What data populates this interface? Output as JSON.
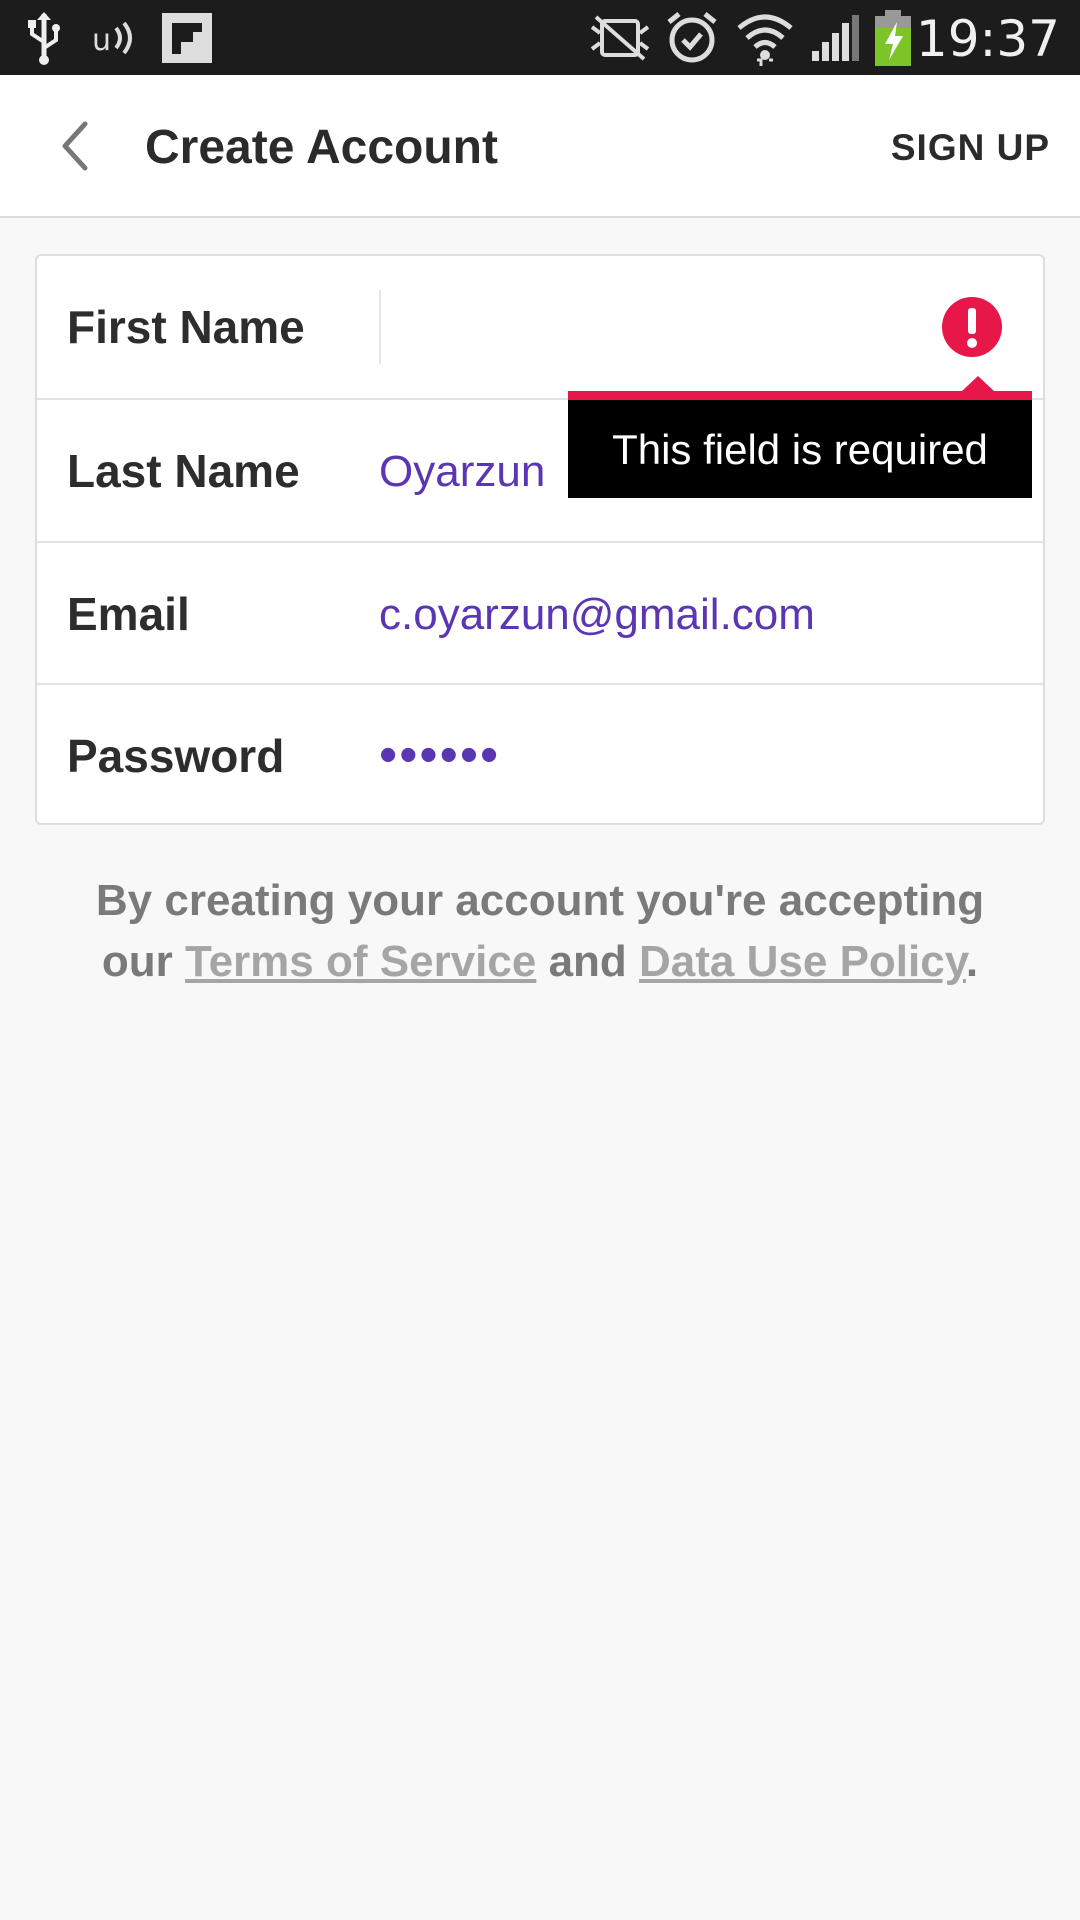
{
  "status_bar": {
    "time": "19:37",
    "icons": [
      "usb-icon",
      "nfc-icon",
      "flipboard-icon",
      "mute-icon",
      "alarm-icon",
      "wifi-icon",
      "signal-icon",
      "battery-charging-icon"
    ],
    "battery_color": "#7cc428"
  },
  "header": {
    "title": "Create Account",
    "signup_label": "SIGN UP"
  },
  "form": {
    "fields": [
      {
        "label": "First Name",
        "value": "",
        "error": true
      },
      {
        "label": "Last Name",
        "value": "Oyarzun"
      },
      {
        "label": "Email",
        "value": "c.oyarzun@gmail.com"
      },
      {
        "label": "Password",
        "value": "••••••"
      }
    ],
    "error_message": "This field is required"
  },
  "terms": {
    "line1": "By creating your account you're accepting",
    "prefix": "our",
    "tos_link": "Terms of Service",
    "and": "and",
    "policy_link": "Data Use Policy",
    "suffix": "."
  },
  "colors": {
    "accent": "#5b36b3",
    "error": "#e8174a",
    "status_bar": "#1c1c1c"
  }
}
